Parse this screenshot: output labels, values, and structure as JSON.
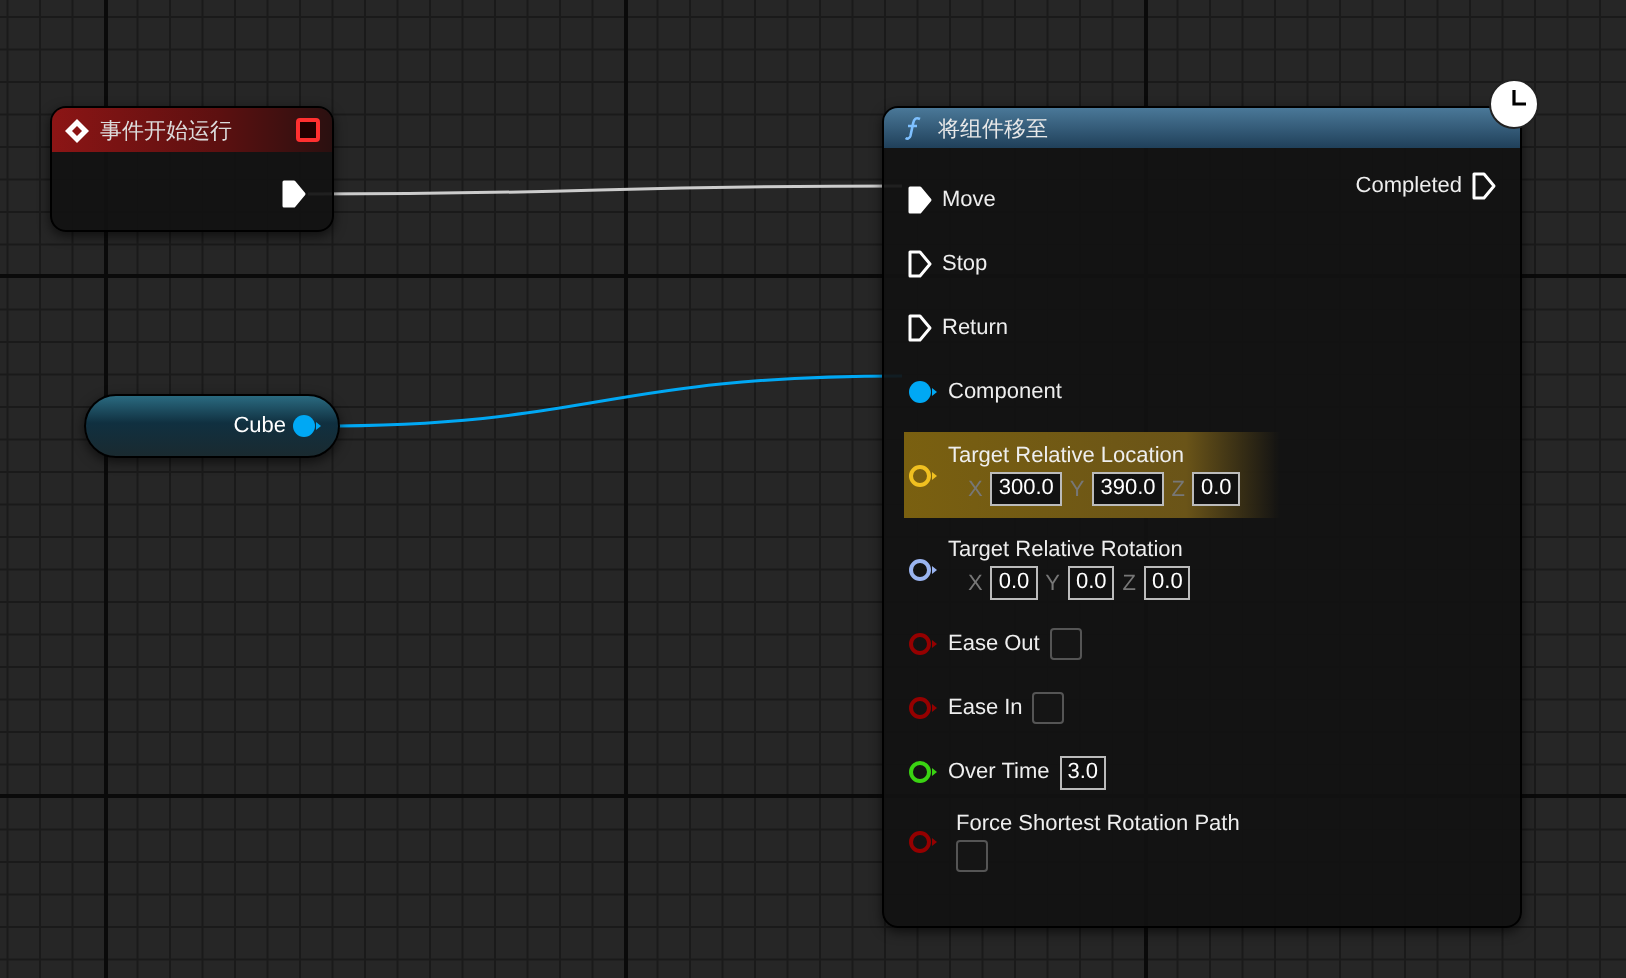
{
  "event_node": {
    "title": "事件开始运行",
    "output_connected": true
  },
  "variable_node": {
    "label": "Cube",
    "color": "#00a8f4",
    "connected": true
  },
  "function_node": {
    "title": "将组件移至",
    "output": {
      "label": "Completed",
      "connected": false
    },
    "inputs": [
      {
        "kind": "exec",
        "label": "Move",
        "connected": true
      },
      {
        "kind": "exec",
        "label": "Stop",
        "connected": false
      },
      {
        "kind": "exec",
        "label": "Return",
        "connected": false
      },
      {
        "kind": "object",
        "label": "Component",
        "connected": true,
        "color": "#00a8f4"
      },
      {
        "kind": "vector",
        "label": "Target Relative Location",
        "connected": false,
        "highlighted": true,
        "color": "#f0c020",
        "fields": [
          {
            "axis": "X",
            "value": "300.0"
          },
          {
            "axis": "Y",
            "value": "390.0"
          },
          {
            "axis": "Z",
            "value": "0.0"
          }
        ]
      },
      {
        "kind": "vector",
        "label": "Target Relative Rotation",
        "connected": false,
        "highlighted": false,
        "color": "#9ab4f0",
        "fields": [
          {
            "axis": "X",
            "value": "0.0"
          },
          {
            "axis": "Y",
            "value": "0.0"
          },
          {
            "axis": "Z",
            "value": "0.0"
          }
        ]
      },
      {
        "kind": "bool",
        "label": "Ease Out",
        "connected": false,
        "checked": false,
        "color": "#950000"
      },
      {
        "kind": "bool",
        "label": "Ease In",
        "connected": false,
        "checked": false,
        "color": "#950000"
      },
      {
        "kind": "float",
        "label": "Over Time",
        "connected": false,
        "color": "#3ad312",
        "value": "3.0"
      },
      {
        "kind": "bool_below",
        "label": "Force Shortest Rotation Path",
        "connected": false,
        "checked": false,
        "color": "#950000"
      }
    ]
  }
}
